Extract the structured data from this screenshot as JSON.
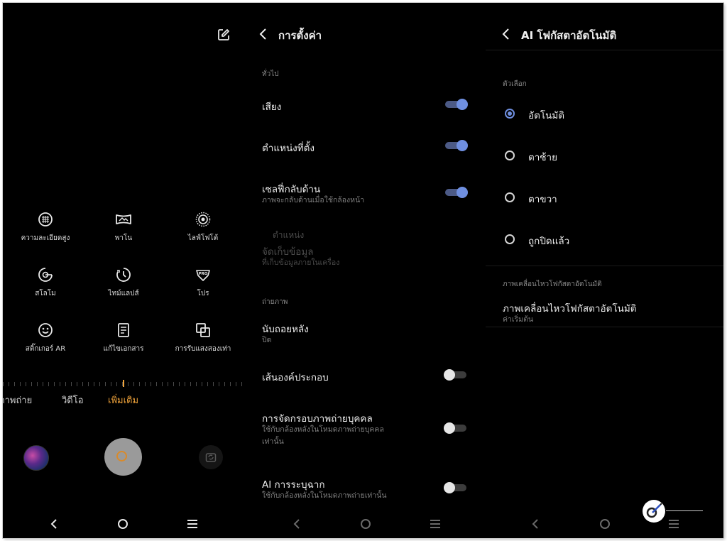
{
  "camera": {
    "modes": [
      {
        "icon": "hi-res-icon",
        "label": "ความละเอียดสูง"
      },
      {
        "icon": "panorama-icon",
        "label": "พาโน"
      },
      {
        "icon": "live-photo-icon",
        "label": "ไลฟ์โฟโต้"
      },
      {
        "icon": "slow-motion-icon",
        "label": "สโลโม"
      },
      {
        "icon": "timelapse-icon",
        "label": "ไทม์แลปส์"
      },
      {
        "icon": "pro-icon",
        "label": "โปร"
      },
      {
        "icon": "ar-sticker-icon",
        "label": "สติ๊กเกอร์ AR"
      },
      {
        "icon": "document-icon",
        "label": "แก้ไขเอกสาร"
      },
      {
        "icon": "dual-exposure-icon",
        "label": "การรับแสงสองเท่า"
      }
    ],
    "tabs": [
      "ภาพถ่าย",
      "วิดีโอ",
      "เพิ่มเติม"
    ],
    "active_tab": "เพิ่มเติม",
    "accent_color": "#f0a33a"
  },
  "settings": {
    "title": "การตั้งค่า",
    "general_label": "ทั่วไป",
    "sound": {
      "title": "เสียง",
      "on": true
    },
    "location": {
      "title": "ตำแหน่งที่ตั้ง",
      "on": true
    },
    "mirror_selfie": {
      "title": "เซลฟี่กลับด้าน",
      "subtitle": "ภาพจะกลับด้านเมื่อใช้กล้องหน้า",
      "on": true
    },
    "storage_location": {
      "prefix": "ตำแหน่ง",
      "title": "จัดเก็บข้อมูล",
      "subtitle": "ที่เก็บข้อมูลภายในเครื่อง"
    },
    "photo_label": "ถ่ายภาพ",
    "countdown": {
      "title": "นับถอยหลัง",
      "value": "ปิด"
    },
    "grid_lines": {
      "title": "เส้นองค์ประกอบ",
      "on": false
    },
    "portrait_framing": {
      "title": "การจัดกรอบภาพถ่ายบุคคล",
      "subtitle_1": "ใช้กับกล้องหลังในโหมดภาพถ่ายบุคคล",
      "subtitle_2": "เท่านั้น",
      "on": false
    },
    "ai_scene": {
      "title": "AI การระบุฉาก",
      "subtitle": "ใช้กับกล้องหลังในโหมดภาพถ่ายเท่านั้น",
      "on": false
    },
    "toggle_on_color": "#6f8fe0"
  },
  "ai_focus": {
    "title": "AI โฟกัสตาอัตโนมัติ",
    "options_label": "ตัวเลือก",
    "options": [
      "อัตโนมัติ",
      "ตาซ้าย",
      "ตาขวา",
      "ถูกปิดแล้ว"
    ],
    "selected": "อัตโนมัติ",
    "motion_section_label": "ภาพเคลื่อนไหวโฟกัสตาอัตโนมัติ",
    "motion_title": "ภาพเคลื่อนไหวโฟกัสตาอัตโนมัติ",
    "motion_value": "ค่าเริ่มต้น"
  }
}
